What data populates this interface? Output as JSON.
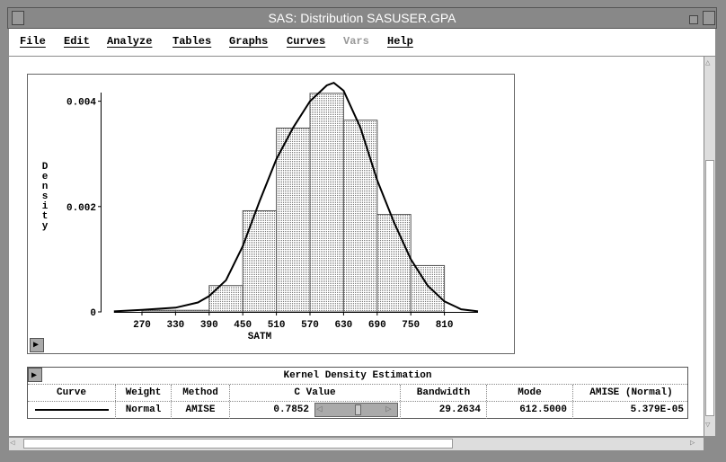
{
  "window": {
    "title": "SAS: Distribution SASUSER.GPA"
  },
  "menu": [
    {
      "label": "File",
      "enabled": true
    },
    {
      "label": "Edit",
      "enabled": true
    },
    {
      "label": "Analyze",
      "enabled": true
    },
    {
      "label": "Tables",
      "enabled": true
    },
    {
      "label": "Graphs",
      "enabled": true
    },
    {
      "label": "Curves",
      "enabled": true
    },
    {
      "label": "Vars",
      "enabled": false
    },
    {
      "label": "Help",
      "enabled": true
    }
  ],
  "chart_data": {
    "type": "bar",
    "xlabel": "SATM",
    "ylabel": "Density",
    "xlim": [
      220,
      870
    ],
    "ylim": [
      0,
      0.0044
    ],
    "xticks": [
      "270",
      "330",
      "390",
      "450",
      "510",
      "570",
      "630",
      "690",
      "750",
      "810"
    ],
    "yticks": [
      "0",
      "0.002",
      "0.004"
    ],
    "bins": [
      {
        "from": 270,
        "to": 330,
        "density": 3e-05
      },
      {
        "from": 330,
        "to": 390,
        "density": 3e-05
      },
      {
        "from": 390,
        "to": 450,
        "density": 0.0005
      },
      {
        "from": 450,
        "to": 510,
        "density": 0.00192
      },
      {
        "from": 510,
        "to": 570,
        "density": 0.00349
      },
      {
        "from": 570,
        "to": 630,
        "density": 0.00415
      },
      {
        "from": 630,
        "to": 690,
        "density": 0.00364
      },
      {
        "from": 690,
        "to": 750,
        "density": 0.00185
      },
      {
        "from": 750,
        "to": 810,
        "density": 0.00088
      }
    ],
    "curve": {
      "x": [
        220,
        270,
        330,
        370,
        390,
        420,
        450,
        480,
        510,
        540,
        570,
        600,
        612.5,
        630,
        660,
        690,
        720,
        750,
        780,
        810,
        840,
        870
      ],
      "y": [
        1e-05,
        4e-05,
        8e-05,
        0.00018,
        0.0003,
        0.0006,
        0.00125,
        0.0021,
        0.0029,
        0.0035,
        0.004,
        0.0043,
        0.00435,
        0.0042,
        0.0035,
        0.0025,
        0.0017,
        0.001,
        0.0005,
        0.0002,
        5e-05,
        1e-05
      ]
    }
  },
  "kde_table": {
    "title": "Kernel Density Estimation",
    "headers": [
      "Curve",
      "Weight",
      "Method",
      "C Value",
      "Bandwidth",
      "Mode",
      "AMISE (Normal)"
    ],
    "row": {
      "weight": "Normal",
      "method": "AMISE",
      "c_value": "0.7852",
      "bandwidth": "29.2634",
      "mode": "612.5000",
      "amise": "5.379E-05"
    }
  }
}
